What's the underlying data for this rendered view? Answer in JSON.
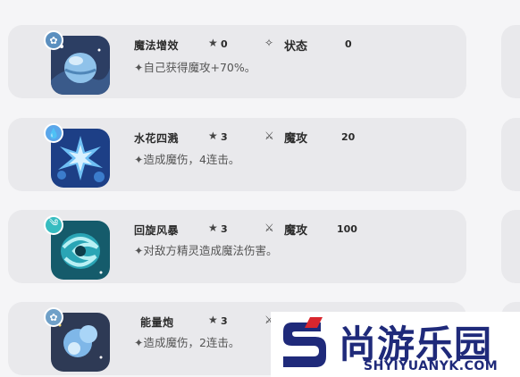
{
  "skills": [
    {
      "name": "魔法增效",
      "star_value": "0",
      "type_label": "状态",
      "type_value": "0",
      "description": "✦自己获得魔攻+70%。",
      "icon": "magic-boost-icon",
      "type_icon": "sparkle-icon",
      "badge_icon": "status-badge-icon"
    },
    {
      "name": "水花四溅",
      "star_value": "3",
      "type_label": "魔攻",
      "type_value": "20",
      "description": "✦造成魔伤，4连击。",
      "icon": "water-splash-icon",
      "type_icon": "magic-attack-icon",
      "badge_icon": "water-badge-icon"
    },
    {
      "name": "回旋风暴",
      "star_value": "3",
      "type_label": "魔攻",
      "type_value": "100",
      "description": "✦对敌方精灵造成魔法伤害。",
      "icon": "whirlwind-icon",
      "type_icon": "magic-attack-icon",
      "badge_icon": "wind-badge-icon"
    },
    {
      "name": "能量炮",
      "star_value": "3",
      "type_label": "",
      "type_value": "",
      "description": "✦造成魔伤，2连击。",
      "icon": "energy-cannon-icon",
      "type_icon": "magic-attack-icon",
      "badge_icon": "normal-badge-icon"
    }
  ],
  "watermark": {
    "text": "尚游乐园",
    "url": "SHYIYUANYK.COM"
  },
  "colors": {
    "card_bg": "#e9e9ec",
    "page_bg": "#f5f5f7",
    "watermark_navy": "#1f2a7a",
    "watermark_red": "#d8262e"
  }
}
